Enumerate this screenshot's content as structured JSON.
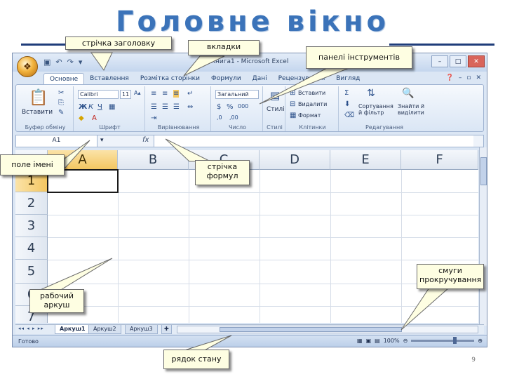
{
  "slide": {
    "title": "Головне вікно",
    "page_number": "9",
    "colors": {
      "title": "#3b73b9",
      "rule": "#1f3d7a",
      "callout_bg": "#fefee2"
    }
  },
  "callouts": {
    "title_bar": "стрічка заголовку",
    "tabs": "вкладки",
    "toolbars": "панелі інструментів",
    "name_box": "поле імені",
    "formula_bar": "стрічка формул",
    "worksheet": "рабочий аркуш",
    "scrollbars": "смуги прокручування",
    "status_bar": "рядок стану"
  },
  "excel": {
    "window_title": "Книга1 - Microsoft Excel",
    "office_button_icon": "office-logo-icon",
    "qat_icons": [
      "save-icon",
      "undo-icon",
      "redo-icon",
      "customize-icon"
    ],
    "tabs": [
      "Основне",
      "Вставлення",
      "Розмітка сторінки",
      "Формули",
      "Дані",
      "Рецензування",
      "Вигляд"
    ],
    "active_tab": "Основне",
    "groups": [
      {
        "label": "Буфер обміну",
        "button": "Вставити"
      },
      {
        "label": "Шрифт",
        "font": "Calibri",
        "size": "11",
        "styles": [
          "Ж",
          "К",
          "Ч"
        ]
      },
      {
        "label": "Вирівнювання"
      },
      {
        "label": "Число",
        "format": "Загальний"
      },
      {
        "label": "Стилі",
        "button": "Стилі"
      },
      {
        "label": "Клітинки",
        "items": [
          "Вставити",
          "Видалити",
          "Формат"
        ]
      },
      {
        "label": "Редагування",
        "items": [
          "Сортування й фільтр",
          "Знайти й виділити"
        ]
      }
    ],
    "name_box": "A1",
    "fx": "fx",
    "columns": [
      "A",
      "B",
      "C",
      "D",
      "E",
      "F"
    ],
    "rows": [
      "1",
      "2",
      "3",
      "4",
      "5",
      "6",
      "7"
    ],
    "sheet_tabs": [
      "Аркуш1",
      "Аркуш2",
      "Аркуш3"
    ],
    "sheet_nav": "◂◂ ◂ ▸ ▸▸",
    "status": "Готово",
    "zoom": "100%"
  }
}
